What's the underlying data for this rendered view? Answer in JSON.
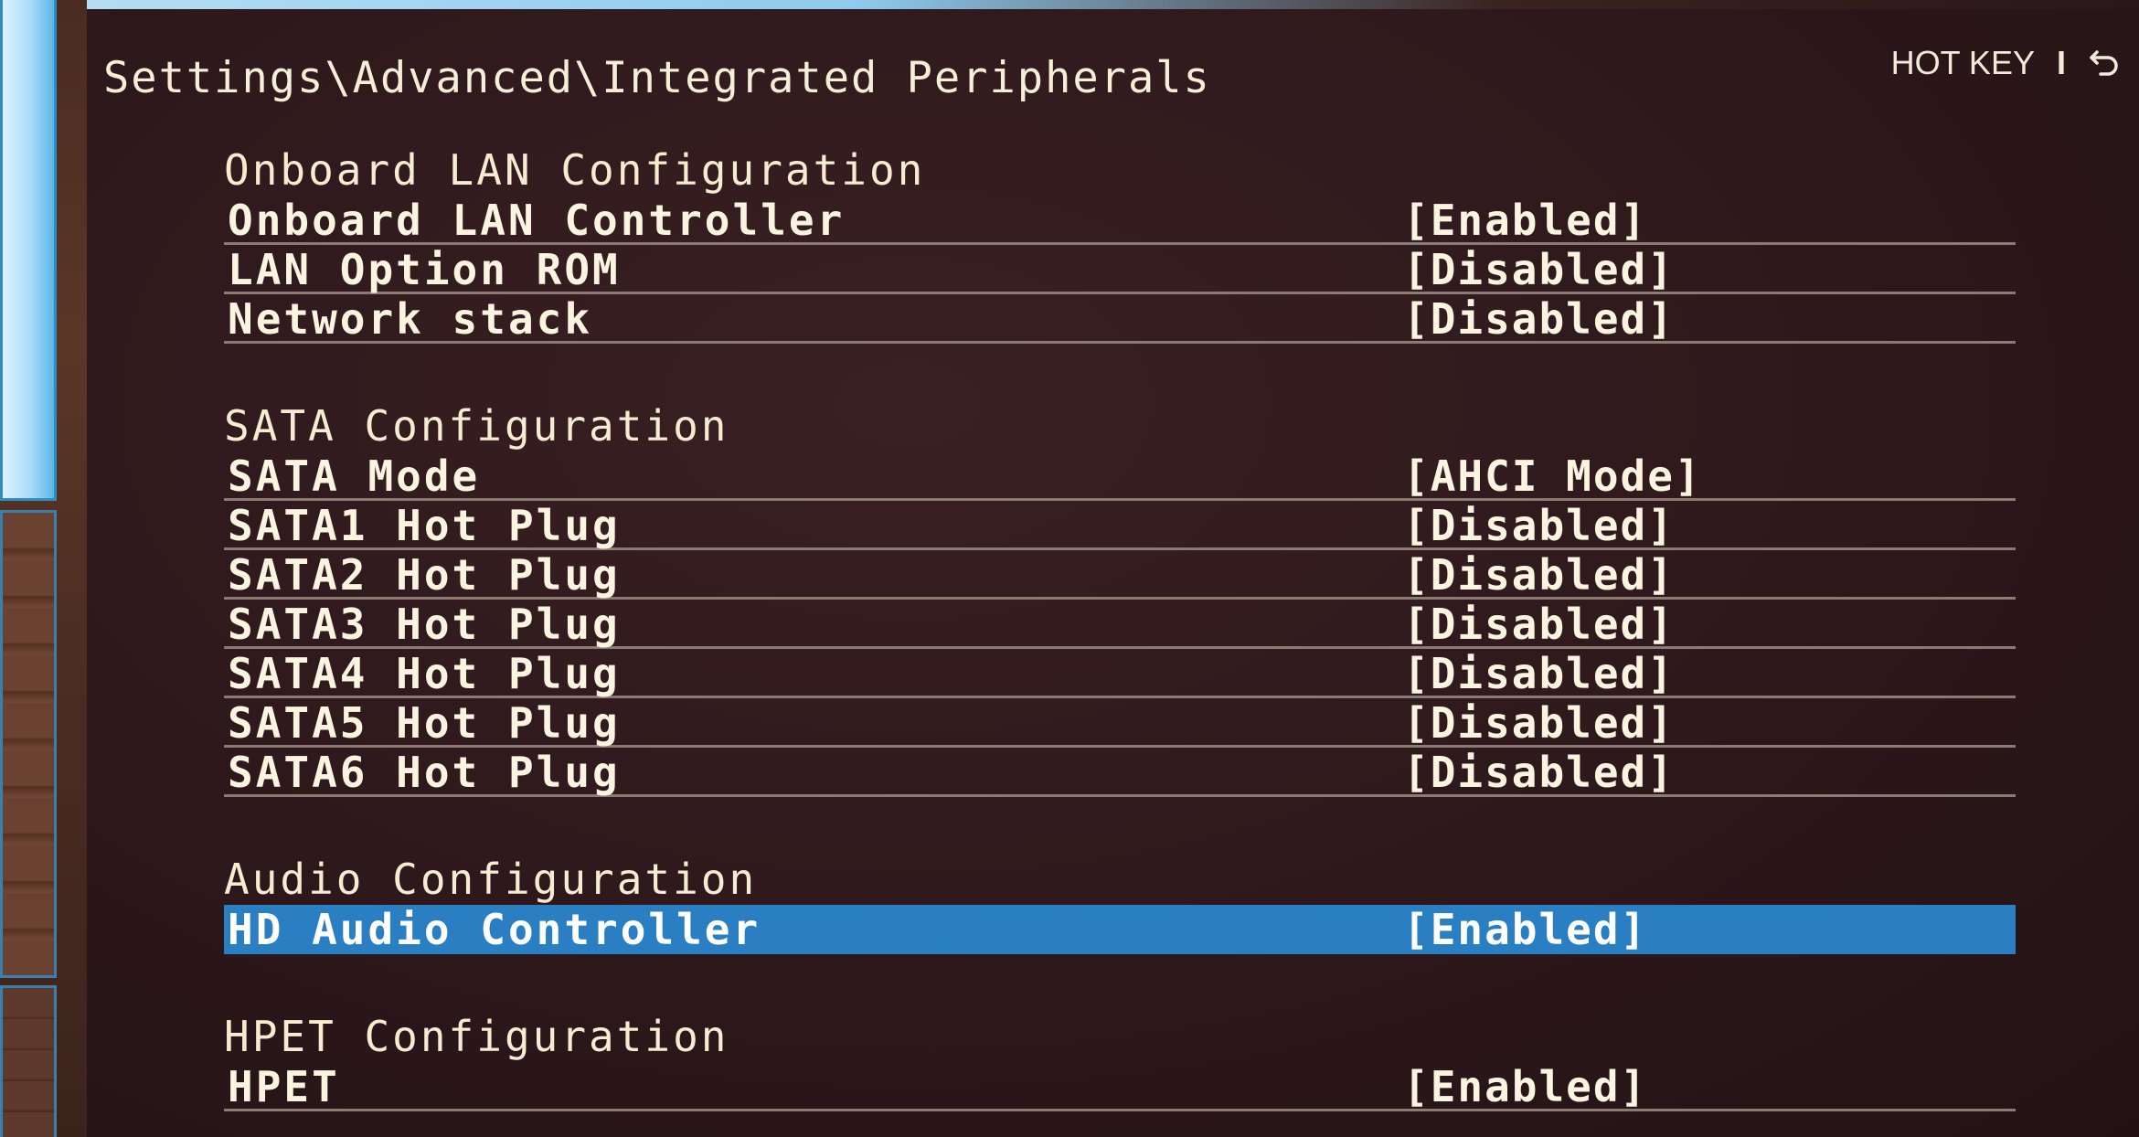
{
  "header": {
    "breadcrumb": "Settings\\Advanced\\Integrated Peripherals",
    "hotkey_label": "HOT KEY",
    "hotkey_separator": "I",
    "back_icon": "back-arrow-icon"
  },
  "sections": [
    {
      "title": "Onboard LAN Configuration",
      "items": [
        {
          "label": "Onboard LAN Controller",
          "value": "[Enabled]"
        },
        {
          "label": "LAN Option ROM",
          "value": "[Disabled]"
        },
        {
          "label": "Network stack",
          "value": "[Disabled]"
        }
      ]
    },
    {
      "title": "SATA Configuration",
      "items": [
        {
          "label": "SATA Mode",
          "value": "[AHCI Mode]"
        },
        {
          "label": "SATA1 Hot Plug",
          "value": "[Disabled]"
        },
        {
          "label": "SATA2 Hot Plug",
          "value": "[Disabled]"
        },
        {
          "label": "SATA3 Hot Plug",
          "value": "[Disabled]"
        },
        {
          "label": "SATA4 Hot Plug",
          "value": "[Disabled]"
        },
        {
          "label": "SATA5 Hot Plug",
          "value": "[Disabled]"
        },
        {
          "label": "SATA6 Hot Plug",
          "value": "[Disabled]"
        }
      ]
    },
    {
      "title": "Audio Configuration",
      "items": [
        {
          "label": "HD Audio Controller",
          "value": "[Enabled]",
          "selected": true
        }
      ]
    },
    {
      "title": "HPET Configuration",
      "items": [
        {
          "label": "HPET",
          "value": "[Enabled]"
        }
      ]
    }
  ],
  "colors": {
    "background": "#2d181b",
    "text": "#fbf4e0",
    "highlight": "#2a7fc2",
    "divider": "#8b7b72"
  }
}
